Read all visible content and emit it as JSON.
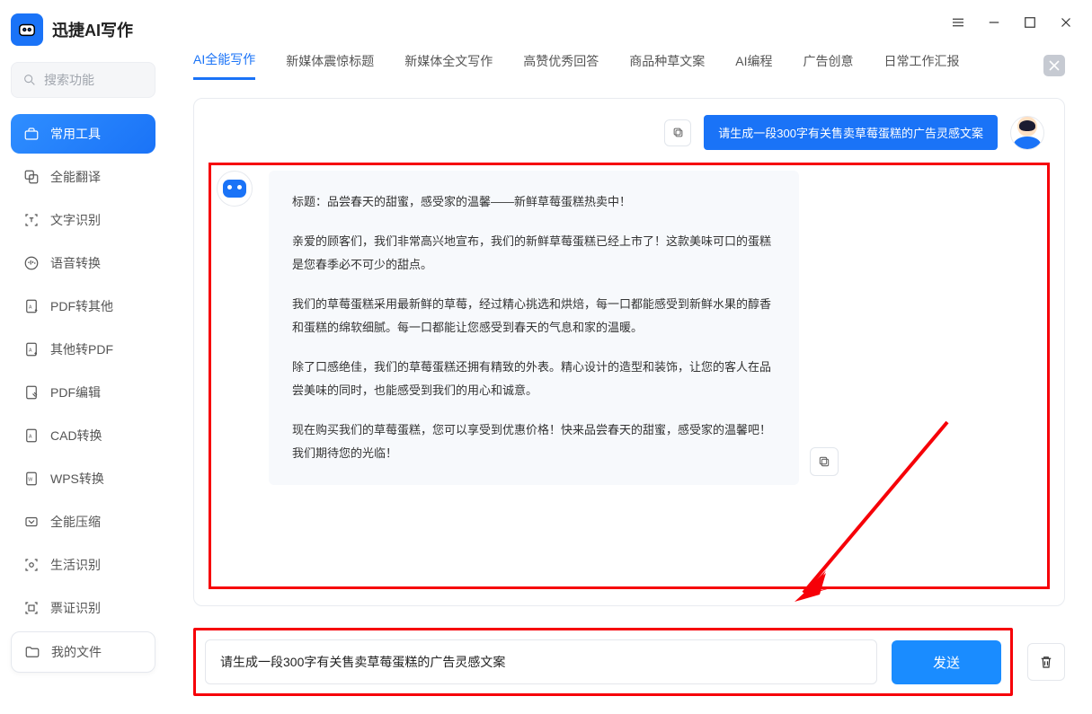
{
  "app_name": "迅捷AI写作",
  "search": {
    "placeholder": "搜索功能"
  },
  "sidebar": {
    "items": [
      {
        "label": "常用工具",
        "icon": "toolbox-icon"
      },
      {
        "label": "全能翻译",
        "icon": "translate-icon"
      },
      {
        "label": "文字识别",
        "icon": "ocr-icon"
      },
      {
        "label": "语音转换",
        "icon": "audio-icon"
      },
      {
        "label": "PDF转其他",
        "icon": "pdf-out-icon"
      },
      {
        "label": "其他转PDF",
        "icon": "pdf-in-icon"
      },
      {
        "label": "PDF编辑",
        "icon": "pdf-edit-icon"
      },
      {
        "label": "CAD转换",
        "icon": "cad-icon"
      },
      {
        "label": "WPS转换",
        "icon": "wps-icon"
      },
      {
        "label": "全能压缩",
        "icon": "compress-icon"
      },
      {
        "label": "生活识别",
        "icon": "life-scan-icon"
      },
      {
        "label": "票证识别",
        "icon": "ticket-icon"
      },
      {
        "label": "我的文件",
        "icon": "folder-icon"
      }
    ]
  },
  "tabs": [
    "AI全能写作",
    "新媒体震惊标题",
    "新媒体全文写作",
    "高赞优秀回答",
    "商品种草文案",
    "AI编程",
    "广告创意",
    "日常工作汇报"
  ],
  "chat": {
    "user_message": "请生成一段300字有关售卖草莓蛋糕的广告灵感文案",
    "ai_response": {
      "p1": "标题：品尝春天的甜蜜，感受家的温馨——新鲜草莓蛋糕热卖中！",
      "p2": "亲爱的顾客们，我们非常高兴地宣布，我们的新鲜草莓蛋糕已经上市了！这款美味可口的蛋糕是您春季必不可少的甜点。",
      "p3": "我们的草莓蛋糕采用最新鲜的草莓，经过精心挑选和烘焙，每一口都能感受到新鲜水果的醇香和蛋糕的绵软细腻。每一口都能让您感受到春天的气息和家的温暖。",
      "p4": "除了口感绝佳，我们的草莓蛋糕还拥有精致的外表。精心设计的造型和装饰，让您的客人在品尝美味的同时，也能感受到我们的用心和诚意。",
      "p5": "现在购买我们的草莓蛋糕，您可以享受到优惠价格！快来品尝春天的甜蜜，感受家的温馨吧！我们期待您的光临！"
    }
  },
  "input": {
    "value": "请生成一段300字有关售卖草莓蛋糕的广告灵感文案",
    "send_label": "发送"
  }
}
